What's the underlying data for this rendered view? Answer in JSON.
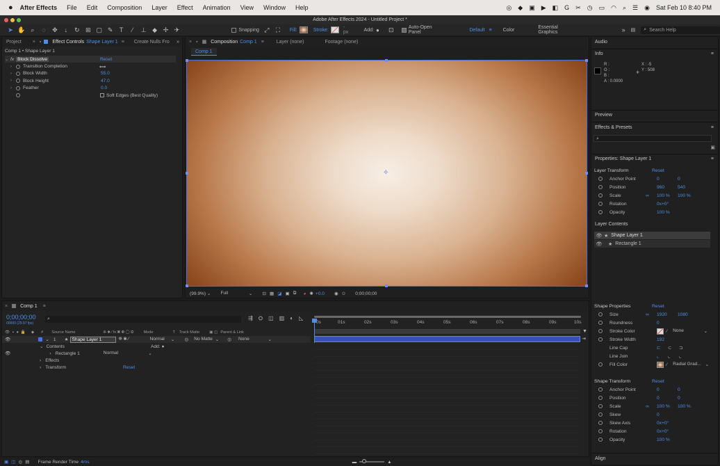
{
  "menubar": {
    "app": "After Effects",
    "items": [
      "File",
      "Edit",
      "Composition",
      "Layer",
      "Effect",
      "Animation",
      "View",
      "Window",
      "Help"
    ],
    "datetime": "Sat Feb 10  8:40 PM"
  },
  "window_title": "Adobe After Effects 2024 - Untitled Project *",
  "toolbar": {
    "snapping": "Snapping",
    "fill": "Fill:",
    "stroke": "Stroke:",
    "stroke_px": "- px",
    "add": "Add:",
    "auto_open": "Auto-Open Panel",
    "workspace_default": "Default",
    "workspace_color": "Color",
    "workspace_essential": "Essential Graphics",
    "search_placeholder": "Search Help"
  },
  "left_panel": {
    "tab_project": "Project",
    "tab_effect_controls": "Effect Controls",
    "tab_effect_controls_target": "Shape Layer 1",
    "tab_create_nulls": "Create Nulls Fro",
    "breadcrumb": "Comp 1 • Shape Layer 1",
    "effect_name": "Block Dissolve",
    "reset": "Reset",
    "props": [
      {
        "label": "Transition Completion",
        "value": ""
      },
      {
        "label": "Block Width",
        "value": "55.0"
      },
      {
        "label": "Block Height",
        "value": "47.0"
      },
      {
        "label": "Feather",
        "value": "0.0"
      }
    ],
    "soft_edges": "Soft Edges (Best Quality)"
  },
  "viewer": {
    "tab_composition": "Composition",
    "tab_comp_name": "Comp 1",
    "tab_layer": "Layer (none)",
    "tab_footage": "Footage (none)",
    "comp_label": "Comp 1",
    "zoom": "(99.9%)",
    "resolution": "Full",
    "exposure": "+0.0",
    "timecode": "0;00;00;00"
  },
  "timeline": {
    "tab": "Comp 1",
    "timecode": "0;00;00;00",
    "timecode_sub": "00000 (29.97 fps)",
    "columns": {
      "source": "Source Name",
      "mode": "Mode",
      "t": "T",
      "track_matte": "Track Matte",
      "parent": "Parent & Link"
    },
    "layer": {
      "num": "1",
      "name": "Shape Layer 1",
      "mode": "Normal",
      "matte": "No Matte",
      "parent": "None"
    },
    "contents": "Contents",
    "add": "Add:",
    "rectangle": "Rectangle 1",
    "rect_mode": "Normal",
    "effects": "Effects",
    "transform": "Transform",
    "transform_reset": "Reset",
    "ruler": [
      "0s",
      "01s",
      "02s",
      "03s",
      "04s",
      "05s",
      "06s",
      "07s",
      "08s",
      "09s",
      "10s"
    ]
  },
  "right_panel": {
    "audio": "Audio",
    "info": "Info",
    "info_r": "R :",
    "info_g": "G :",
    "info_b": "B :",
    "info_a": "A :  0.0000",
    "info_x": "X : -5",
    "info_y": "Y :  508",
    "preview": "Preview",
    "effects_presets": "Effects & Presets",
    "properties_title": "Properties: Shape Layer 1",
    "layer_transform": "Layer Transform",
    "reset": "Reset",
    "layer_props": [
      {
        "label": "Anchor Point",
        "v1": "0",
        "v2": "0"
      },
      {
        "label": "Position",
        "v1": "960",
        "v2": "540"
      },
      {
        "label": "Scale",
        "v1": "100 %",
        "v2": "100 %"
      },
      {
        "label": "Rotation",
        "v1": "0x+0°",
        "v2": ""
      },
      {
        "label": "Opacity",
        "v1": "100 %",
        "v2": ""
      }
    ],
    "layer_contents": "Layer Contents",
    "contents_items": [
      "Shape Layer 1",
      "Rectangle 1"
    ],
    "shape_properties": "Shape Properties",
    "shape_props": [
      {
        "label": "Size",
        "v1": "1920",
        "v2": "1080"
      },
      {
        "label": "Roundness",
        "v1": "0",
        "v2": ""
      },
      {
        "label": "Stroke Color",
        "v1": "",
        "v2": "None"
      },
      {
        "label": "Stroke Width",
        "v1": "192",
        "v2": ""
      },
      {
        "label": "Line Cap",
        "v1": "",
        "v2": ""
      },
      {
        "label": "Line Join",
        "v1": "",
        "v2": ""
      },
      {
        "label": "Fill Color",
        "v1": "",
        "v2": "Radial Grad..."
      }
    ],
    "shape_transform": "Shape Transform",
    "shape_transform_props": [
      {
        "label": "Anchor Point",
        "v1": "0",
        "v2": "0"
      },
      {
        "label": "Position",
        "v1": "0",
        "v2": "0"
      },
      {
        "label": "Scale",
        "v1": "100 %",
        "v2": "100 %"
      },
      {
        "label": "Skew",
        "v1": "0",
        "v2": ""
      },
      {
        "label": "Skew Axis",
        "v1": "0x+0°",
        "v2": ""
      },
      {
        "label": "Rotation",
        "v1": "0x+0°",
        "v2": ""
      },
      {
        "label": "Opacity",
        "v1": "100 %",
        "v2": ""
      }
    ],
    "align": "Align"
  },
  "statusbar": {
    "label": "Frame Render Time",
    "value": "4ms"
  },
  "colors": {
    "accent": "#4d8fe8",
    "layer_bar": "#3b4fb8",
    "gradient_center": "#f4ece4",
    "gradient_edge": "#7a3c12"
  }
}
